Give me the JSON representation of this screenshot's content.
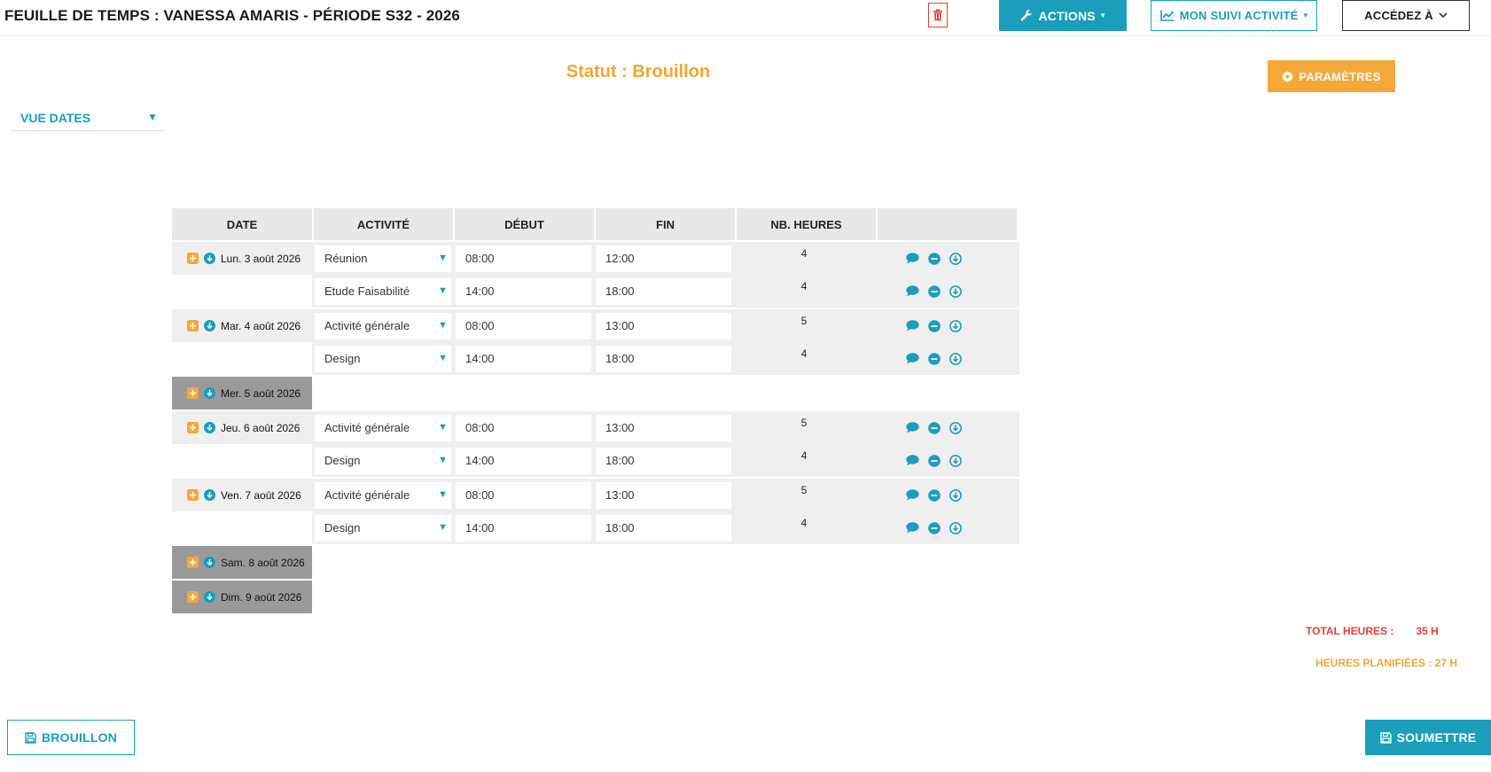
{
  "header": {
    "title": "FEUILLE DE TEMPS : VANESSA AMARIS - PÉRIODE S32 - 2026",
    "actions_label": "ACTIONS",
    "suivi_label": "MON SUIVI ACTIVITÉ",
    "accedez_label": "ACCÉDEZ À"
  },
  "status": "Statut : Brouillon",
  "params_label": "PARAMÈTRES",
  "view_selector": "VUE DATES",
  "columns": [
    "DATE",
    "ACTIVITÉ",
    "DÉBUT",
    "FIN",
    "NB. HEURES",
    ""
  ],
  "days": [
    {
      "label": "Lun. 3 août 2026",
      "active": true,
      "entries": [
        {
          "activity": "Réunion",
          "start": "08:00",
          "end": "12:00",
          "hours": "4"
        },
        {
          "activity": "Etude Faisabilité",
          "start": "14:00",
          "end": "18:00",
          "hours": "4"
        }
      ]
    },
    {
      "label": "Mar. 4 août 2026",
      "active": true,
      "entries": [
        {
          "activity": "Activité générale",
          "start": "08:00",
          "end": "13:00",
          "hours": "5"
        },
        {
          "activity": "Design",
          "start": "14:00",
          "end": "18:00",
          "hours": "4"
        }
      ]
    },
    {
      "label": "Mer. 5 août 2026",
      "active": false,
      "entries": []
    },
    {
      "label": "Jeu. 6 août 2026",
      "active": true,
      "entries": [
        {
          "activity": "Activité générale",
          "start": "08:00",
          "end": "13:00",
          "hours": "5"
        },
        {
          "activity": "Design",
          "start": "14:00",
          "end": "18:00",
          "hours": "4"
        }
      ]
    },
    {
      "label": "Ven. 7 août 2026",
      "active": true,
      "entries": [
        {
          "activity": "Activité générale",
          "start": "08:00",
          "end": "13:00",
          "hours": "5"
        },
        {
          "activity": "Design",
          "start": "14:00",
          "end": "18:00",
          "hours": "4"
        }
      ]
    },
    {
      "label": "Sam. 8 août 2026",
      "active": false,
      "entries": []
    },
    {
      "label": "Dim. 9 août 2026",
      "active": false,
      "entries": []
    }
  ],
  "totals": {
    "total_label": "TOTAL HEURES :",
    "total_value": "35 H",
    "planned": "HEURES PLANIFIÉES : 27 H"
  },
  "footer": {
    "draft_label": "BROUILLON",
    "submit_label": "SOUMETTRE"
  },
  "colors": {
    "primary": "#1a9ebb",
    "accent": "#f5a83a",
    "danger": "#e0403a"
  }
}
